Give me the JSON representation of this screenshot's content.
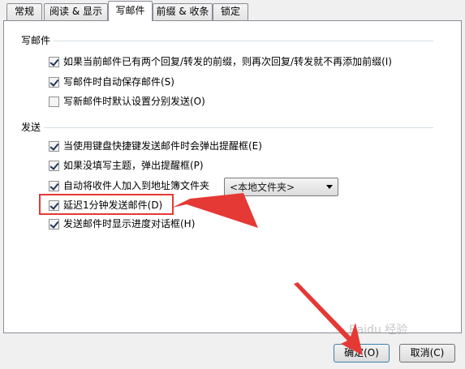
{
  "tabs": [
    {
      "label": "常规"
    },
    {
      "label": "阅读 & 显示"
    },
    {
      "label": "写邮件",
      "active": true
    },
    {
      "label": "前缀 & 收条"
    },
    {
      "label": "锁定"
    }
  ],
  "compose_group": {
    "title": "写邮件",
    "options": [
      {
        "label": "如果当前邮件已有两个回复/转发的前缀，则再次回复/转发就不再添加前缀(I)",
        "checked": true
      },
      {
        "label": "写邮件时自动保存邮件(S)",
        "checked": true
      },
      {
        "label": "写新邮件时默认设置分别发送(O)",
        "checked": false
      }
    ]
  },
  "send_group": {
    "title": "发送",
    "options": [
      {
        "label": "当使用键盘快捷键发送邮件时会弹出提醒框(E)",
        "checked": true
      },
      {
        "label": "如果没填写主题，弹出提醒框(P)",
        "checked": true
      },
      {
        "label": "自动将收件人加入到地址簿文件夹",
        "checked": true
      },
      {
        "label": "延迟1分钟发送邮件(D)",
        "checked": true
      },
      {
        "label": "发送邮件时显示进度对话框(H)",
        "checked": true
      }
    ],
    "folder_select": {
      "value": "<本地文件夹>"
    }
  },
  "buttons": {
    "ok": "确定(O)",
    "cancel": "取消(C)"
  },
  "watermark": "Baidu 经验",
  "colors": {
    "annotation": "#e53935",
    "panel_border": "#898c95"
  }
}
